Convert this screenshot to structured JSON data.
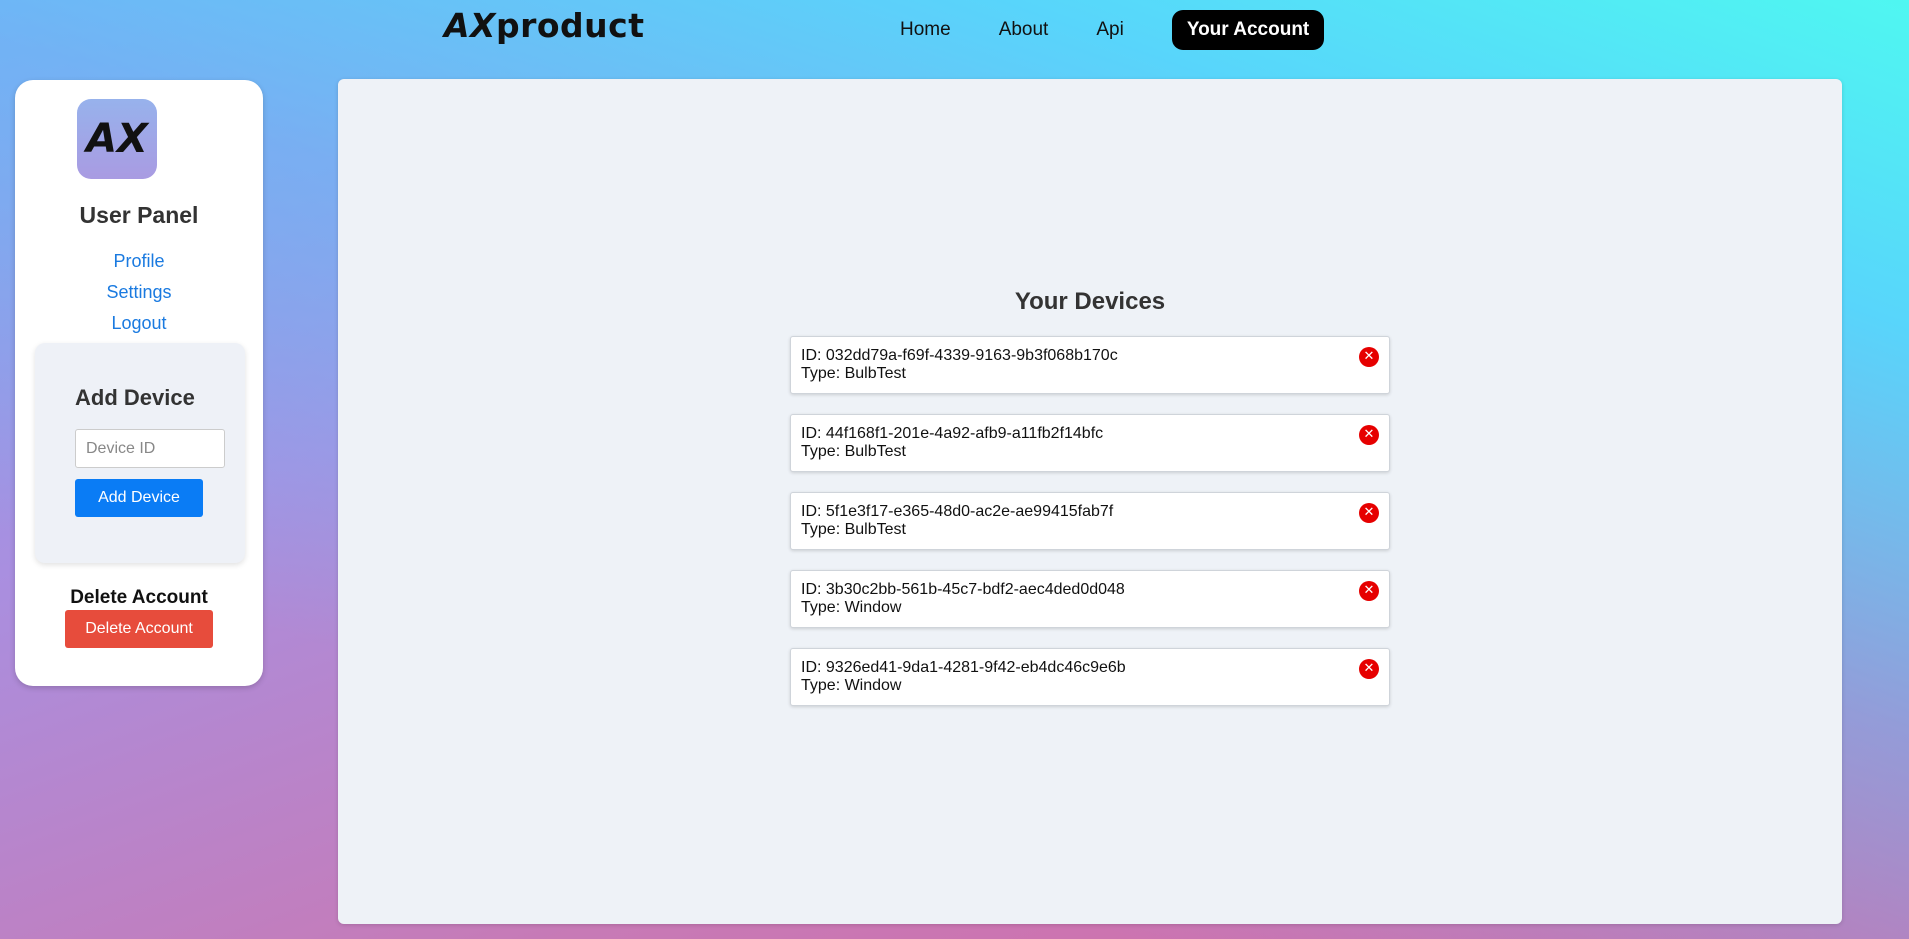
{
  "header": {
    "brand_prefix": "AX",
    "brand_suffix": "product",
    "nav": [
      {
        "label": "Home"
      },
      {
        "label": "About"
      },
      {
        "label": "Api"
      },
      {
        "label": "Your Account"
      }
    ]
  },
  "sidebar": {
    "logo_text": "AX",
    "title": "User Panel",
    "links": [
      {
        "label": "Profile"
      },
      {
        "label": "Settings"
      },
      {
        "label": "Logout"
      }
    ],
    "add_device": {
      "title": "Add Device",
      "input_placeholder": "Device ID",
      "button_label": "Add Device"
    },
    "delete_account": {
      "heading": "Delete Account",
      "button_label": "Delete Account"
    }
  },
  "main": {
    "title": "Your Devices",
    "remove_icon": "close-icon",
    "devices": [
      {
        "id_line": "ID: 032dd79a-f69f-4339-9163-9b3f068b170c",
        "type_line": "Type: BulbTest"
      },
      {
        "id_line": "ID: 44f168f1-201e-4a92-afb9-a11fb2f14bfc",
        "type_line": "Type: BulbTest"
      },
      {
        "id_line": "ID: 5f1e3f17-e365-48d0-ac2e-ae99415fab7f",
        "type_line": "Type: BulbTest"
      },
      {
        "id_line": "ID: 3b30c2bb-561b-45c7-bdf2-aec4ded0d048",
        "type_line": "Type: Window"
      },
      {
        "id_line": "ID: 9326ed41-9da1-4281-9f42-eb4dc46c9e6b",
        "type_line": "Type: Window"
      }
    ]
  },
  "colors": {
    "primary_button": "#0a7cf5",
    "danger_button": "#e74c3c",
    "link": "#1a7ae0",
    "remove_icon": "#e60000"
  }
}
